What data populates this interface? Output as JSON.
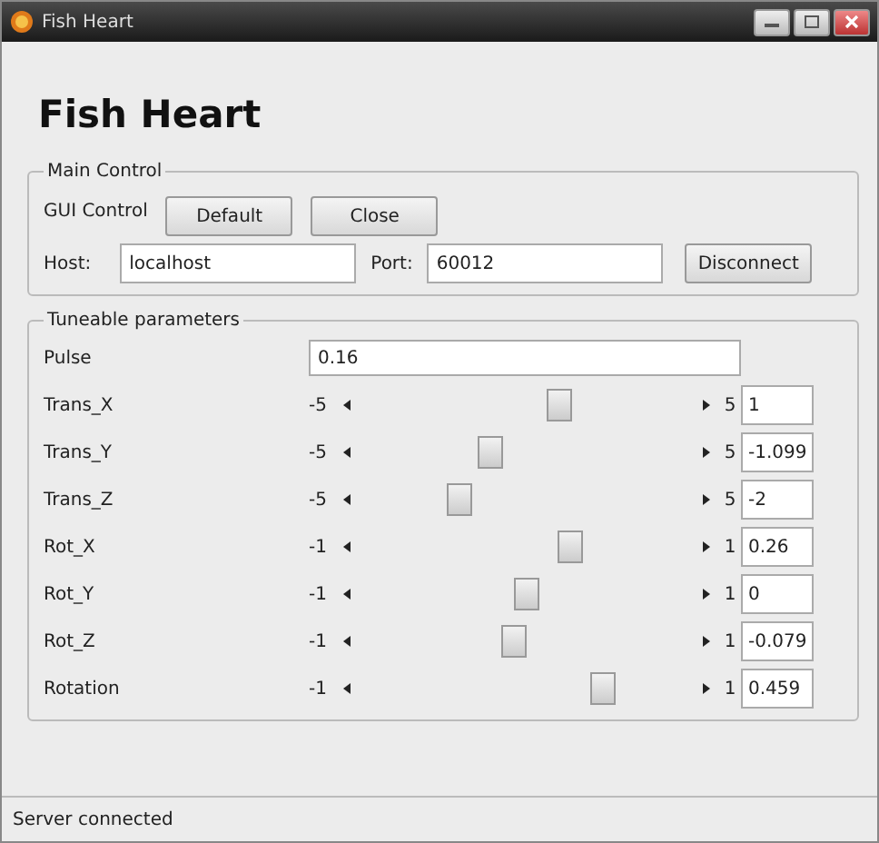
{
  "window": {
    "title": "Fish Heart"
  },
  "heading": "Fish Heart",
  "main_control": {
    "title": "Main Control",
    "gui_label": "GUI Control",
    "buttons": [
      "Default",
      "Close"
    ],
    "host_label": "Host:",
    "host": "localhost",
    "port_label": "Port:",
    "port": "60012",
    "connect_button": "Disconnect"
  },
  "parameters": {
    "title": "Tuneable parameters",
    "pulse_label": "Pulse",
    "pulse": "0.16",
    "sliders": [
      {
        "name": "Trans_X",
        "min": "-5",
        "max": "5",
        "level": 0.6,
        "value": "1"
      },
      {
        "name": "Trans_Y",
        "min": "-5",
        "max": "5",
        "level": 0.39,
        "value": "-1.099"
      },
      {
        "name": "Trans_Z",
        "min": "-5",
        "max": "5",
        "level": 0.3,
        "value": "-2"
      },
      {
        "name": "Rot_X",
        "min": "-1",
        "max": "1",
        "level": 0.63,
        "value": "0.26"
      },
      {
        "name": "Rot_Y",
        "min": "-1",
        "max": "1",
        "level": 0.5,
        "value": "0"
      },
      {
        "name": "Rot_Z",
        "min": "-1",
        "max": "1",
        "level": 0.46,
        "value": "-0.079"
      },
      {
        "name": "Rotation",
        "min": "-1",
        "max": "1",
        "level": 0.73,
        "value": "0.459"
      }
    ]
  },
  "status_bar": "Server connected"
}
